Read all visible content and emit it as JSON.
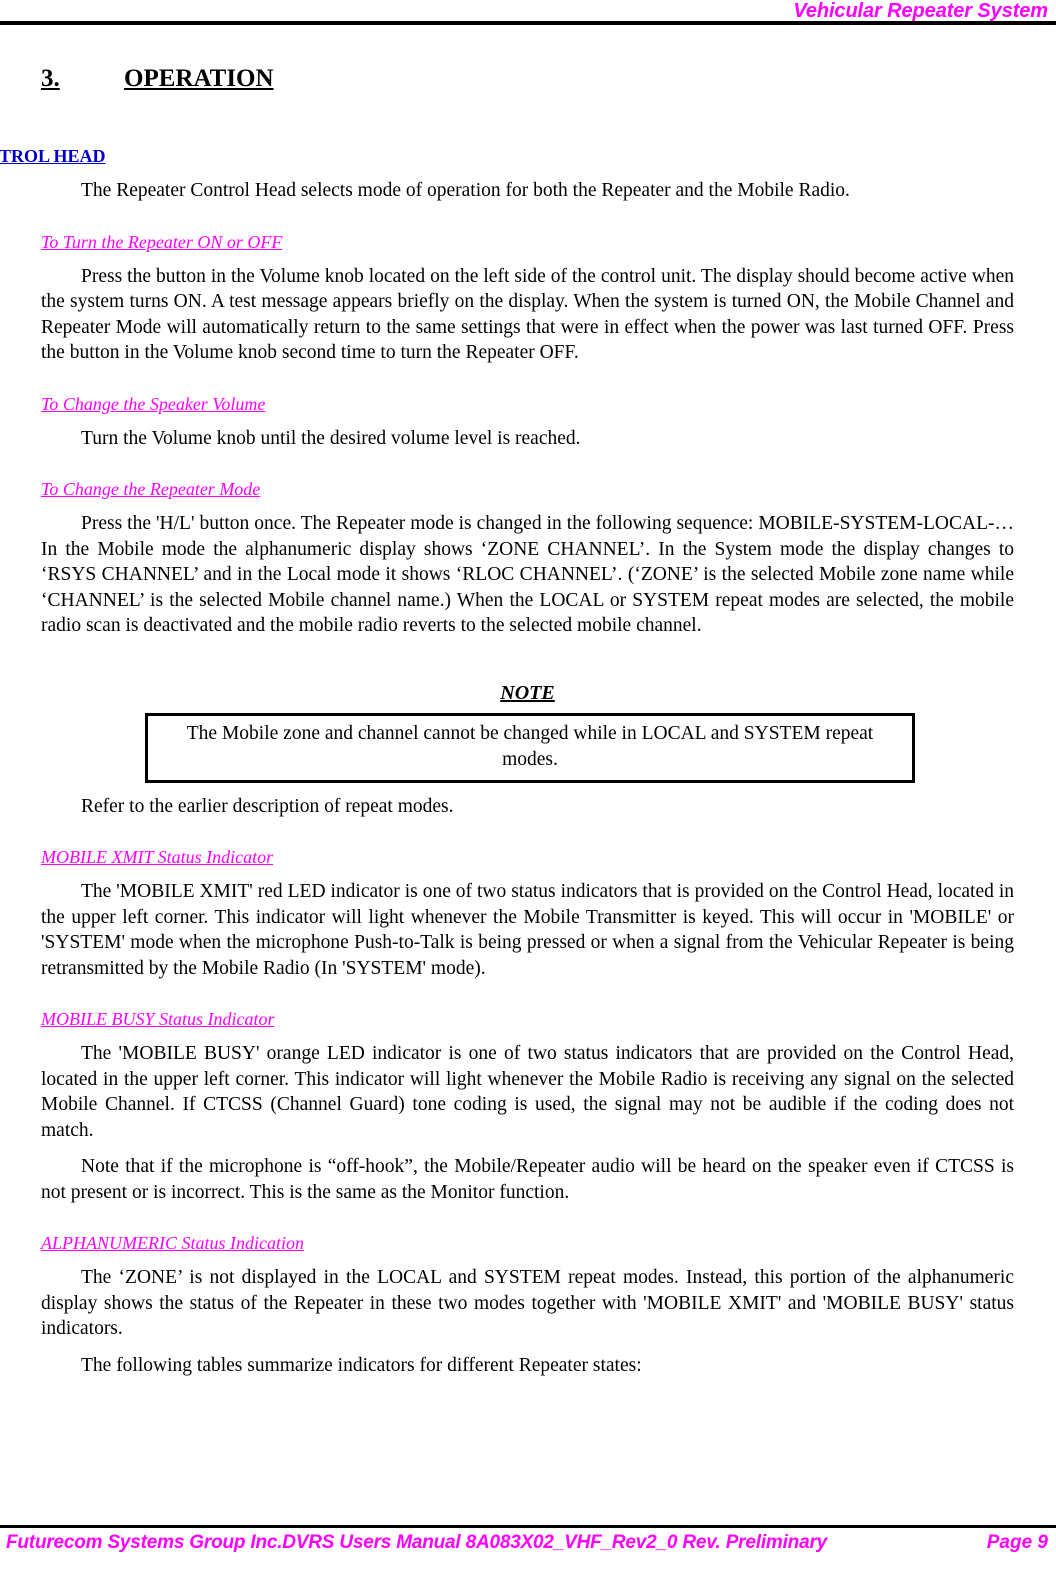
{
  "header": {
    "title": "Vehicular Repeater System"
  },
  "section": {
    "number": "3.",
    "title": "OPERATION"
  },
  "subsection": {
    "title": "CONTROL HEAD"
  },
  "intro": {
    "paragraph": "The Repeater Control Head selects mode of operation for both the Repeater and the Mobile Radio."
  },
  "topics": [
    {
      "heading": "To Turn the Repeater ON or OFF",
      "paragraphs": [
        "Press the button in the Volume knob located on the left side of the control unit. The display should become active when the system turns ON. A test message appears briefly on the display. When the system is turned ON, the Mobile Channel and Repeater Mode will automatically return to the same settings that were in effect when the power was last turned OFF. Press the button in the Volume knob second time to turn the Repeater OFF."
      ]
    },
    {
      "heading": "To Change the Speaker Volume",
      "paragraphs": [
        "Turn the Volume knob until the desired volume level is reached."
      ]
    },
    {
      "heading": "To Change the Repeater Mode",
      "paragraphs": [
        "Press the 'H/L' button once. The Repeater mode is changed in the following sequence: MOBILE-SYSTEM-LOCAL-… In the Mobile mode the alphanumeric display shows ‘ZONE CHANNEL’. In the System mode the display changes to ‘RSYS CHANNEL’ and in the Local mode it shows ‘RLOC CHANNEL’. (‘ZONE’ is the selected Mobile zone name while ‘CHANNEL’ is the selected Mobile channel name.) When the LOCAL or SYSTEM repeat modes are selected, the mobile radio scan is deactivated and the mobile radio reverts to the selected mobile channel."
      ]
    }
  ],
  "note": {
    "label": "NOTE",
    "text": "The Mobile zone and channel cannot be changed while in LOCAL and SYSTEM repeat modes."
  },
  "after_note": {
    "paragraph": "Refer to the earlier description of repeat modes."
  },
  "topics2": [
    {
      "heading": "MOBILE XMIT Status Indicator",
      "paragraphs": [
        "The 'MOBILE XMIT' red LED indicator is one of two status indicators that is provided on the Control Head, located in the upper left corner. This indicator will light whenever the Mobile Transmitter is keyed. This will occur in 'MOBILE' or 'SYSTEM' mode when the microphone Push-to-Talk is being pressed or when a signal from the Vehicular Repeater is being retransmitted by the Mobile Radio (In 'SYSTEM' mode)."
      ]
    },
    {
      "heading": "MOBILE BUSY Status Indicator",
      "paragraphs": [
        "The 'MOBILE BUSY' orange LED indicator is one of two status indicators that are provided on the Control Head, located in the upper left corner. This indicator will light whenever the Mobile Radio is receiving any signal on the selected Mobile Channel. If CTCSS (Channel Guard) tone coding is used, the signal may not be audible if the coding does not match.",
        "Note that if the microphone is “off-hook”, the Mobile/Repeater audio will be heard on the speaker even if CTCSS is not present or is incorrect. This is the same as the Monitor function."
      ]
    },
    {
      "heading": "ALPHANUMERIC Status Indication",
      "paragraphs": [
        "The ‘ZONE’ is not displayed in the LOCAL and SYSTEM repeat modes. Instead, this portion of the alphanumeric display shows the status of the Repeater in these two modes together with 'MOBILE XMIT' and 'MOBILE BUSY' status indicators.",
        "The following tables summarize indicators for different Repeater states:"
      ]
    }
  ],
  "footer": {
    "left": "Futurecom Systems Group Inc.DVRS Users Manual 8A083X02_VHF_Rev2_0 Rev. Preliminary",
    "right": "Page 9"
  },
  "colors": {
    "accent_magenta": "#ff00ff",
    "link_blue": "#0000cc",
    "text": "#000000"
  }
}
